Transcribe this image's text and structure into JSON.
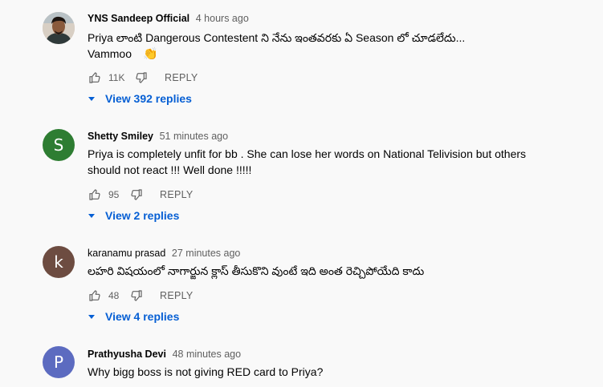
{
  "comments": [
    {
      "author": "YNS Sandeep Official",
      "time": "4 hours ago",
      "text_line1": "Priya లాంటి Dangerous Contestent ని నేను ఇంతవరకు ఏ Season లో చూడలేదు...",
      "text_line2": "Vammoo",
      "emoji": "👏",
      "likes": "11K",
      "reply_label": "REPLY",
      "view_replies": "View 392 replies",
      "avatar_type": "photo"
    },
    {
      "author": "Shetty Smiley",
      "time": "51 minutes ago",
      "text_line1": "Priya is completely unfit for bb . She can lose her words on National Telivision but others",
      "text_line2": "should not react !!! Well done !!!!!",
      "likes": "95",
      "reply_label": "REPLY",
      "view_replies": "View 2 replies",
      "avatar_letter": "S",
      "avatar_color": "#2e7d32"
    },
    {
      "author": "karanamu prasad",
      "time": "27 minutes ago",
      "text_line1": "లహరి విషయంలో నాగార్జున క్లాస్ తీసుకొని వుంటే ఇది అంత రెచ్చిపోయేది కాదు",
      "likes": "48",
      "reply_label": "REPLY",
      "view_replies": "View 4 replies",
      "avatar_letter": "k",
      "avatar_color": "#6d4c41"
    },
    {
      "author": "Prathyusha Devi",
      "time": "48 minutes ago",
      "text_line1": "Why bigg boss is not giving RED card to Priya?",
      "avatar_letter": "P",
      "avatar_color": "#5c6bc0"
    }
  ],
  "colors": {
    "link_blue": "#065fd4",
    "secondary_text": "#606060",
    "background": "#f9f9f9"
  },
  "icons": {
    "like": "thumbs-up-icon",
    "dislike": "thumbs-down-icon",
    "expand": "caret-down-icon",
    "clap": "clapping-hands-emoji"
  }
}
